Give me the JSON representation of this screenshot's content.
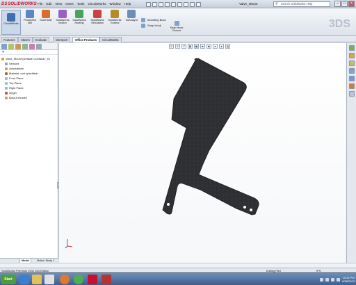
{
  "app": {
    "brand_ds": "DS",
    "brand_name": "SOLIDWORKS",
    "menus": [
      "File",
      "Edit",
      "View",
      "Insert",
      "Tools",
      "CircuitWorks",
      "Window",
      "Help"
    ],
    "document_title": "Valve_Mount",
    "search_placeholder": "Search SolidWorks Help",
    "window_controls": [
      "minimize-icon",
      "maximize-icon",
      "close-icon"
    ],
    "watermark": "3DS"
  },
  "command_manager": {
    "circuitworks": "CircuitWorks",
    "photoview": "PhotoView 360",
    "scanto3d": "ScanTo3D",
    "motion": "SolidWorks Motion",
    "routing": "SolidWorks Routing",
    "simulation": "SolidWorks Simulation",
    "toolbox": "SolidWorks Toolbox",
    "tolanalyst": "TolAnalyst",
    "mounting_boss": "Mounting Boss",
    "snap_hook": "Snap Hook",
    "snap_hook_groove": "Snap Hook Groove"
  },
  "tabs": {
    "features": "Features",
    "sketch": "Sketch",
    "evaluate": "Evaluate",
    "dimxpert": "DimXpert",
    "office_products": "Office Products",
    "circuitworks": "CircuitWorks",
    "active": "Office Products"
  },
  "feature_tree": {
    "items": [
      {
        "label": "Valve_Mount  (Default<<Default>_Di",
        "icon": "part-icon"
      },
      {
        "label": "Sensors",
        "icon": "sensor-icon"
      },
      {
        "label": "Annotations",
        "icon": "annotation-icon"
      },
      {
        "label": "Material <not specified>",
        "icon": "material-icon"
      },
      {
        "label": "Front Plane",
        "icon": "plane-icon"
      },
      {
        "label": "Top Plane",
        "icon": "plane-icon"
      },
      {
        "label": "Right Plane",
        "icon": "plane-icon"
      },
      {
        "label": "Origin",
        "icon": "origin-icon"
      },
      {
        "label": "Boss-Extrude1",
        "icon": "extrude-icon"
      }
    ],
    "filter_icon": "filter-icon",
    "splitter_label": "Model"
  },
  "bottom_tabs": {
    "model": "Model",
    "motion_study": "Motion Study 1"
  },
  "status_bar": {
    "left_text": "SolidWorks Premium 2012 x64 Edition",
    "editing": "Editing Part",
    "units": "IPS"
  },
  "taskbar": {
    "start": "Start",
    "clock_time": "10:44 PM",
    "clock_date": "8/28/2013"
  },
  "colors": {
    "part_fill": "#2e3033",
    "part_edge": "#1a1b1d",
    "accent": "#3f6fb0"
  }
}
